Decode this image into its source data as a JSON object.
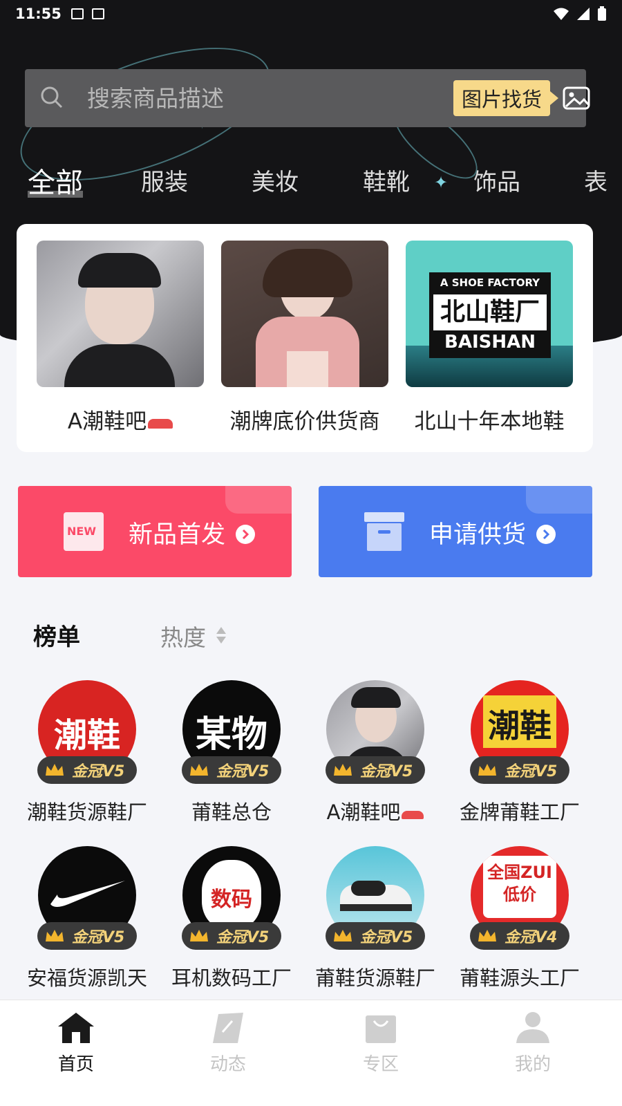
{
  "status_bar": {
    "time": "11:55"
  },
  "search": {
    "placeholder": "搜索商品描述",
    "image_search_label": "图片找货"
  },
  "categories": [
    "全部",
    "服装",
    "美妆",
    "鞋靴",
    "饰品",
    "表"
  ],
  "featured": [
    {
      "name": "A潮鞋吧"
    },
    {
      "name": "潮牌底价供货商"
    },
    {
      "name": "北山十年本地鞋",
      "image_text": [
        "A SHOE FACTORY",
        "北山鞋厂",
        "BAISHAN"
      ]
    }
  ],
  "actions": {
    "new_arrivals": {
      "label": "新品首发",
      "icon_text": "NEW",
      "color": "#fb4a68"
    },
    "apply_supply": {
      "label": "申请供货",
      "color": "#4a7bef"
    }
  },
  "ranking": {
    "title": "榜单",
    "sort_label": "热度",
    "shops": [
      {
        "name": "潮鞋货源鞋厂",
        "badge": "金冠V5",
        "avatar_text": "潮鞋"
      },
      {
        "name": "莆鞋总仓",
        "badge": "金冠V5",
        "avatar_text": "某物"
      },
      {
        "name": "A潮鞋吧",
        "badge": "金冠V5",
        "avatar_text": ""
      },
      {
        "name": "金牌莆鞋工厂",
        "badge": "金冠V5",
        "avatar_text": "潮鞋"
      },
      {
        "name": "安福货源凯天",
        "badge": "金冠V5",
        "avatar_text": ""
      },
      {
        "name": "耳机数码工厂",
        "badge": "金冠V5",
        "avatar_text": "数码"
      },
      {
        "name": "莆鞋货源鞋厂",
        "badge": "金冠V5",
        "avatar_text": ""
      },
      {
        "name": "莆鞋源头工厂",
        "badge": "金冠V4",
        "avatar_text": "全国ZUI低价"
      }
    ]
  },
  "nav": [
    {
      "label": "首页",
      "active": true
    },
    {
      "label": "动态",
      "active": false
    },
    {
      "label": "专区",
      "active": false
    },
    {
      "label": "我的",
      "active": false
    }
  ],
  "colors": {
    "accent_gold": "#f7d98a",
    "dark_bg": "#141416",
    "badge_gold": "#f3d27a"
  }
}
